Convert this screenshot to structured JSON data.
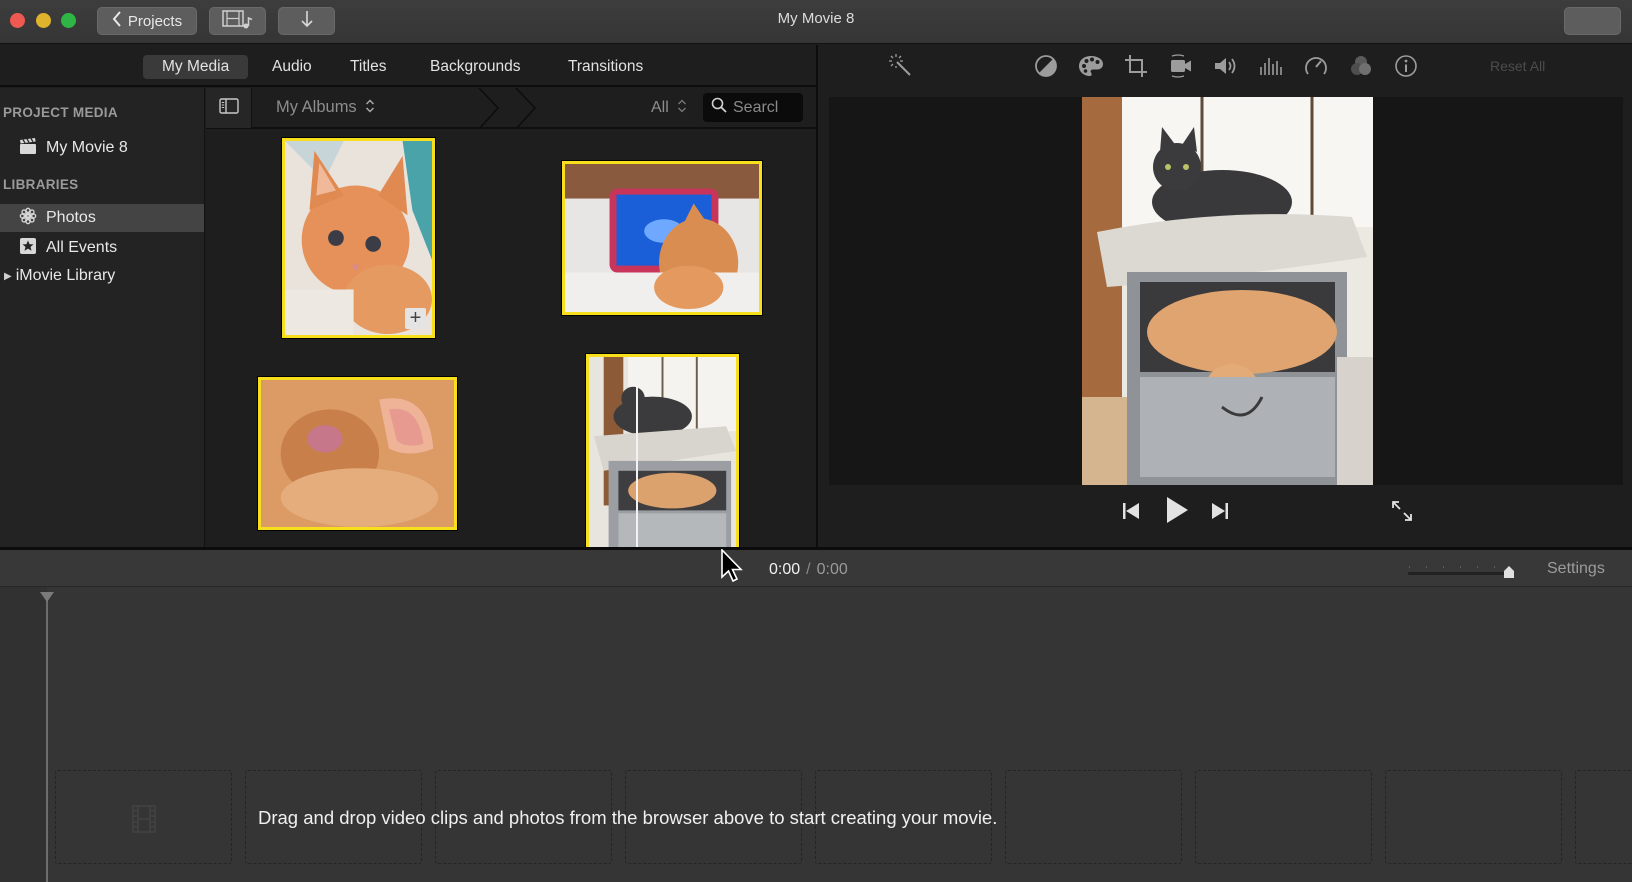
{
  "window": {
    "title": "My Movie 8",
    "toolbar": {
      "projects_label": "Projects",
      "media_toggle_icon": "film-music-icon",
      "import_icon": "arrow-down-icon"
    }
  },
  "browser_tabs": [
    {
      "label": "My Media",
      "active": true
    },
    {
      "label": "Audio",
      "active": false
    },
    {
      "label": "Titles",
      "active": false
    },
    {
      "label": "Backgrounds",
      "active": false
    },
    {
      "label": "Transitions",
      "active": false
    }
  ],
  "sidebar": {
    "project_media_header": "PROJECT MEDIA",
    "project_item": {
      "label": "My Movie 8",
      "icon": "clapperboard-icon"
    },
    "libraries_header": "LIBRARIES",
    "library_items": [
      {
        "label": "Photos",
        "icon": "photos-flower-icon",
        "selected": true
      },
      {
        "label": "All Events",
        "icon": "star-box-icon",
        "selected": false
      }
    ],
    "imovie_library": {
      "label": "iMovie Library",
      "icon": "disclosure-triangle-icon"
    }
  },
  "browser_bar": {
    "album_selector": "My Albums",
    "filter": "All",
    "search_placeholder": "Search",
    "search_visible_text": "Searcl"
  },
  "media_thumbnails": [
    {
      "subject": "orange kitten on blanket",
      "selected": true,
      "add_badge": true
    },
    {
      "subject": "kitten pawing at tablet",
      "selected": true,
      "add_badge": false
    },
    {
      "subject": "orange cat ear close-up",
      "selected": true,
      "add_badge": false
    },
    {
      "subject": "gray and orange cats on cabinet",
      "selected": true,
      "add_badge": false,
      "skimming": true
    }
  ],
  "viewer": {
    "tools": [
      {
        "name": "enhance",
        "icon": "magic-wand-icon"
      },
      {
        "name": "color-balance",
        "icon": "color-balance-icon"
      },
      {
        "name": "color-correction",
        "icon": "palette-icon"
      },
      {
        "name": "crop",
        "icon": "crop-icon"
      },
      {
        "name": "stabilization",
        "icon": "video-camera-icon"
      },
      {
        "name": "volume",
        "icon": "speaker-icon"
      },
      {
        "name": "noise-reduction",
        "icon": "equalizer-icon"
      },
      {
        "name": "speed",
        "icon": "speedometer-icon"
      },
      {
        "name": "clip-filter",
        "icon": "filter-circles-icon"
      },
      {
        "name": "info",
        "icon": "info-icon"
      }
    ],
    "reset_all_label": "Reset All",
    "preview_subject": "gray cat on top of cabinet, orange cat inside",
    "playback": {
      "previous": "skip-back-icon",
      "play": "play-icon",
      "next": "skip-forward-icon",
      "fullscreen": "fullscreen-icon"
    }
  },
  "timeline_bar": {
    "current_time": "0:00",
    "separator": "/",
    "duration": "0:00",
    "settings_label": "Settings",
    "zoom_level": 1.0
  },
  "timeline": {
    "empty_message": "Drag and drop video clips and photos from the browser above to start creating your movie."
  },
  "colors": {
    "selection_yellow": "#f7df1e",
    "background_dark": "#1e1e1e",
    "timeline_bg": "#353535"
  }
}
